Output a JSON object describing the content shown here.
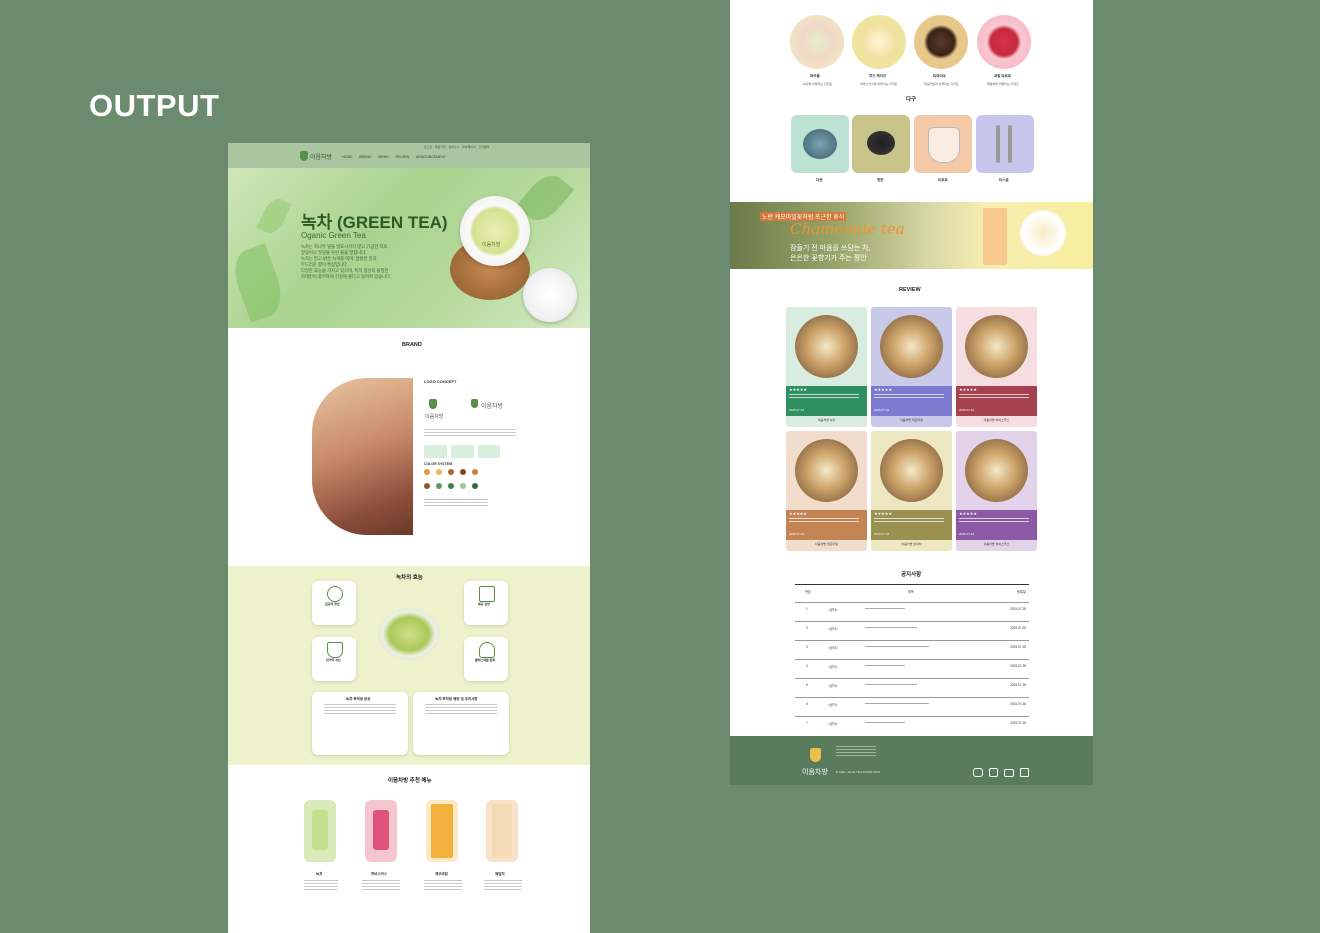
{
  "label": "OUTPUT",
  "top_links": [
    "로그인",
    "회원가입",
    "장바구니",
    "마이페이지",
    "고객센터"
  ],
  "brand_name": "이음차방",
  "nav": [
    "HOME",
    "BRAND",
    "MENU",
    "REVIEW",
    "ANNOUNCEMENT"
  ],
  "hero": {
    "title": "녹차 (GREEN TEA)",
    "subtitle": "Oganic Green Tea",
    "body": [
      "녹차는 차나무 잎을 발효시키지 않고 가공한 차로,",
      "찻잎이나 찻잎을 우린 물을 말합니다.",
      "녹차는 맑고 밝은 녹색을 띠며, 쌉쌀한 맛과",
      "부드러운 향이 특징입니다.",
      "다양한 효능을 가지고 있으며, 특히 항산화 물질인",
      "카테킨이 풍부하여 건강에 좋다고 알려져 있습니다."
    ]
  },
  "brand": {
    "heading": "BRAND",
    "logo_concept": "LOGO CONCEPT",
    "color_system": "COLOR SYSTEM",
    "colors": [
      "#e49a3c",
      "#f0b55a",
      "#a86a2a",
      "#7b4a1c",
      "#c9853a",
      "#8a5a30",
      "#5b9a5e",
      "#3f7f48",
      "#9cc58e",
      "#2f6a3a"
    ]
  },
  "benefits": {
    "heading": "녹차의 효능",
    "cards": [
      "집중력 향상",
      "체중 감량",
      "면역력 개선",
      "콜레스테롤 완화"
    ],
    "note1": "녹차 부작용 증상",
    "note2": "녹차 부작용 예방 및 주의사항"
  },
  "menu_section": {
    "heading": "이음차방 추천 메뉴",
    "items": [
      "녹차",
      "히비스커스",
      "캐모마일",
      "메밀차"
    ]
  },
  "desserts": {
    "items": [
      {
        "name": "마카롱",
        "desc": "녹차와 어울리는 디저트"
      },
      {
        "name": "치즈 케이크",
        "desc": "히비스커스와 어울리는 디저트"
      },
      {
        "name": "티라미수",
        "desc": "캐모마일과 어울리는 디저트"
      },
      {
        "name": "과일 타르트",
        "desc": "메밀차와 어울리는 디저트"
      }
    ]
  },
  "teaware": {
    "heading": "다구",
    "items": [
      "다관",
      "찻잔",
      "티포트",
      "티스푼"
    ]
  },
  "banner": {
    "tagline": "노란 캐모마일꽃처럼 포근한 휴식",
    "title": "Chamomile tea",
    "line1": "잠들기 전 마음을 쓰담는 차,",
    "line2": "은은한 꽃향기가 주는 평안"
  },
  "review": {
    "heading": "REVIEW",
    "stars": "★★★★★",
    "date": "2025.07.22",
    "cards": [
      {
        "bg": "#d9ece2",
        "band": "#2f8f5e",
        "button": "이음차방 녹차"
      },
      {
        "bg": "#c9c9ea",
        "band": "#7a7ad0",
        "button": "이음차방 캐모마일"
      },
      {
        "bg": "#f6dde2",
        "band": "#a5424f",
        "button": "이음차방 히비스커스"
      },
      {
        "bg": "#f2dccb",
        "band": "#c48454",
        "button": "이음차방 캐모마일"
      },
      {
        "bg": "#eee8c2",
        "band": "#9a9050",
        "button": "이음차방 보리차"
      },
      {
        "bg": "#e3d3ea",
        "band": "#8c5aa4",
        "button": "이음차방 히비스커스"
      }
    ]
  },
  "notice": {
    "heading": "공지사항",
    "cols": [
      "번호",
      "제목",
      "등록일"
    ],
    "rows": [
      {
        "n": "1",
        "tag": "<공지>",
        "date": "2025.07.28"
      },
      {
        "n": "2",
        "tag": "<공지>",
        "date": "2025.07.28"
      },
      {
        "n": "3",
        "tag": "<공지>",
        "date": "2025.07.28"
      },
      {
        "n": "4",
        "tag": "<공지>",
        "date": "2025.07.28"
      },
      {
        "n": "5",
        "tag": "<공지>",
        "date": "2025.07.28"
      },
      {
        "n": "6",
        "tag": "<공지>",
        "date": "2025.07.28"
      },
      {
        "n": "7",
        "tag": "<공지>",
        "date": "2025.07.28"
      }
    ]
  },
  "footer": {
    "brand": "이음차방",
    "email": "E-MAIL. IEUM.TEA.ROOM.COM"
  }
}
